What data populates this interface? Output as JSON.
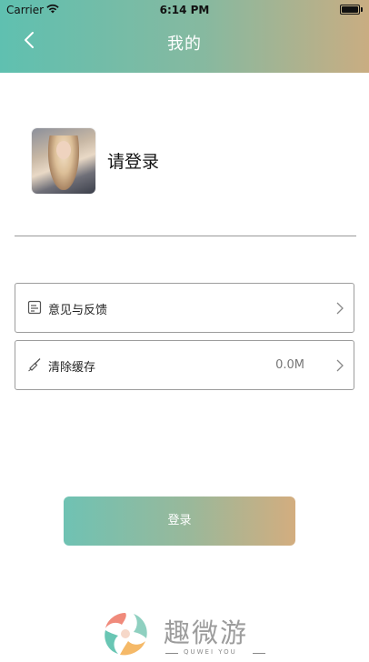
{
  "status_bar": {
    "carrier": "Carrier",
    "time": "6:14 PM"
  },
  "nav": {
    "title": "我的"
  },
  "profile": {
    "login_prompt": "请登录"
  },
  "menu": [
    {
      "label": "意见与反馈",
      "value": ""
    },
    {
      "label": "清除缓存",
      "value": "0.0M"
    }
  ],
  "actions": {
    "login_label": "登录"
  },
  "brand": {
    "name": "趣微游",
    "subtitle": "QUWEI YOU"
  },
  "colors": {
    "gradient_start": "#5fc0b0",
    "gradient_end": "#d3ad7f",
    "border": "#9c9c9c"
  }
}
